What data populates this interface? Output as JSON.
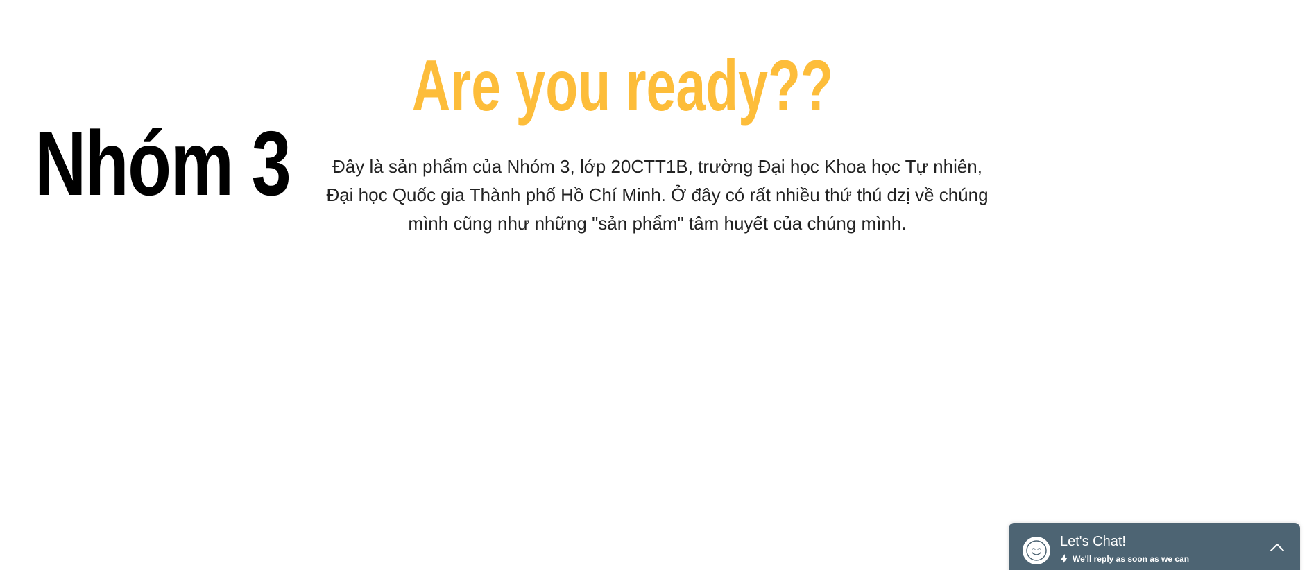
{
  "brand": {
    "title": "Nhóm 3"
  },
  "hero": {
    "title": "Are you ready??",
    "description": "Đây là sản phẩm của Nhóm 3, lớp 20CTT1B, trường Đại học Khoa học Tự nhiên, Đại học Quốc gia Thành phố Hồ Chí Minh. Ở đây có rất nhiều thứ thú dzị về chúng mình cũng như những \"sản phẩm\" tâm huyết của chúng mình.",
    "title_color": "#fdbd3a"
  },
  "chat": {
    "title": "Let's Chat!",
    "subtitle": "We'll reply as soon as we can",
    "avatar_icon": "smiley-icon",
    "status_icon": "bolt-icon",
    "toggle_icon": "chevron-up-icon",
    "background_color": "#4d6473"
  }
}
